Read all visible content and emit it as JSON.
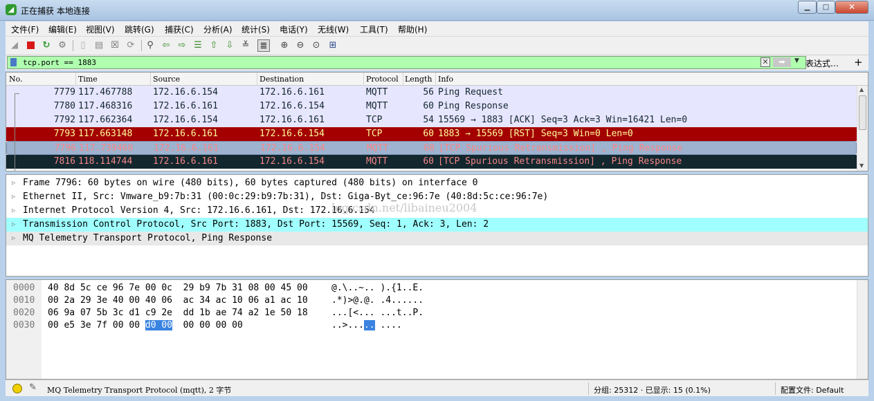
{
  "window": {
    "title": "正在捕获 本地连接",
    "app_icon": "wireshark-fin-icon",
    "min_glyph": "▁",
    "max_glyph": "□",
    "close_glyph": "✕"
  },
  "menu": [
    "文件(F)",
    "编辑(E)",
    "视图(V)",
    "跳转(G)",
    "捕获(C)",
    "分析(A)",
    "统计(S)",
    "电话(Y)",
    "无线(W)",
    "工具(T)",
    "帮助(H)"
  ],
  "toolbar_icons": [
    "start-capture-icon",
    "stop-capture-icon",
    "restart-capture-icon",
    "capture-options-icon",
    "open-file-icon",
    "save-file-icon",
    "close-file-icon",
    "reload-file-icon",
    "find-packet-icon",
    "go-back-icon",
    "go-forward-icon",
    "go-to-packet-icon",
    "first-packet-icon",
    "last-packet-icon",
    "autoscroll-icon",
    "colorize-icon",
    "zoom-in-icon",
    "zoom-out-icon",
    "normal-size-icon",
    "resize-columns-icon"
  ],
  "filter": {
    "value": "tcp.port == 1883",
    "expression_label": "表达式…",
    "plus_label": "+",
    "bg_color": "#afffaf"
  },
  "packet_list": {
    "columns": [
      "No.",
      "Time",
      "Source",
      "Destination",
      "Protocol",
      "Length",
      "Info"
    ],
    "rows": [
      {
        "no": "7779",
        "time": "117.467788",
        "src": "172.16.6.154",
        "dst": "172.16.6.161",
        "proto": "MQTT",
        "len": "56",
        "info": "Ping Request",
        "bg": "#e7e6ff",
        "fg": "#12272e"
      },
      {
        "no": "7780",
        "time": "117.468316",
        "src": "172.16.6.161",
        "dst": "172.16.6.154",
        "proto": "MQTT",
        "len": "60",
        "info": "Ping Response",
        "bg": "#e7e6ff",
        "fg": "#12272e"
      },
      {
        "no": "7792",
        "time": "117.662364",
        "src": "172.16.6.154",
        "dst": "172.16.6.161",
        "proto": "TCP",
        "len": "54",
        "info": "15569 → 1883 [ACK] Seq=3 Ack=3 Win=16421 Len=0",
        "bg": "#e7e6ff",
        "fg": "#12272e"
      },
      {
        "no": "7793",
        "time": "117.663148",
        "src": "172.16.6.161",
        "dst": "172.16.6.154",
        "proto": "TCP",
        "len": "60",
        "info": "1883 → 15569 [RST] Seq=3 Win=0 Len=0",
        "bg": "#a40000",
        "fg": "#fffc9c"
      },
      {
        "no": "7796",
        "time": "117.739460",
        "src": "172.16.6.161",
        "dst": "172.16.6.154",
        "proto": "MQTT",
        "len": "60",
        "info": "[TCP Spurious Retransmission] , Ping Response",
        "bg": "#9db3cf",
        "fg": "#f78787",
        "selected": true
      },
      {
        "no": "7816",
        "time": "118.114744",
        "src": "172.16.6.161",
        "dst": "172.16.6.154",
        "proto": "MQTT",
        "len": "60",
        "info": "[TCP Spurious Retransmission] , Ping Response",
        "bg": "#12272e",
        "fg": "#f78787"
      }
    ]
  },
  "details": {
    "rows": [
      {
        "text": "Frame 7796: 60 bytes on wire (480 bits), 60 bytes captured (480 bits) on interface 0",
        "bg": "#ffffff"
      },
      {
        "text": "Ethernet II, Src: Vmware_b9:7b:31 (00:0c:29:b9:7b:31), Dst: Giga-Byt_ce:96:7e (40:8d:5c:ce:96:7e)",
        "bg": "#ffffff"
      },
      {
        "text": "Internet Protocol Version 4, Src: 172.16.6.161, Dst: 172.16.6.154",
        "bg": "#ffffff"
      },
      {
        "text": "Transmission Control Protocol, Src Port: 1883, Dst Port: 15569, Seq: 1, Ack: 3, Len: 2",
        "bg": "#a0ffff"
      },
      {
        "text": "MQ Telemetry Transport Protocol, Ping Response",
        "bg": "#e8e8e8"
      }
    ],
    "watermark": "log.csdn.net/libaineu2004"
  },
  "hex": {
    "rows": [
      {
        "offset": "0000",
        "hex": "40 8d 5c ce 96 7e 00 0c  29 b9 7b 31 08 00 45 00",
        "ascii": "@.\\..~.. ).{1..E."
      },
      {
        "offset": "0010",
        "hex": "00 2a 29 3e 40 00 40 06  ac 34 ac 10 06 a1 ac 10",
        "ascii": ".*)>@.@. .4......"
      },
      {
        "offset": "0020",
        "hex": "06 9a 07 5b 3c d1 c9 2e  dd 1b ae 74 a2 1e 50 18",
        "ascii": "...[<... ...t..P."
      },
      {
        "offset": "0030",
        "hex_pre": "00 e5 3e 7f 00 00 ",
        "hex_sel": "d0 00",
        "hex_post": "  00 00 00 00",
        "ascii_pre": "..>...",
        "ascii_sel": "..",
        "ascii_post": " ...."
      }
    ]
  },
  "status": {
    "text": "MQ Telemetry Transport Protocol (mqtt), 2 字节",
    "stats": "分组: 25312 · 已显示: 15 (0.1%)",
    "profile": "配置文件: Default"
  }
}
